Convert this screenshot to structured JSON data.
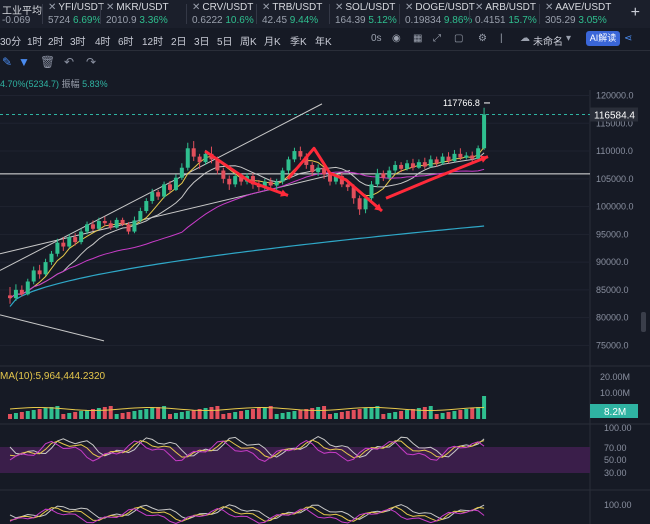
{
  "tickers": [
    {
      "name": "工业平均",
      "price": "-0.069",
      "change": "",
      "pos": 0,
      "closable": false,
      "color": "#e24f5c"
    },
    {
      "name": "YFI/USDT",
      "price": "5724",
      "change": "6.69%",
      "pos": 46,
      "closable": true,
      "color": "#2fbf8f"
    },
    {
      "name": "MKR/USDT",
      "price": "2010.9",
      "change": "3.36%",
      "pos": 104,
      "closable": true,
      "color": "#2fbf8f"
    },
    {
      "name": "CRV/USDT",
      "price": "0.6222",
      "change": "10.6%",
      "pos": 190,
      "closable": true,
      "color": "#2fbf8f"
    },
    {
      "name": "TRB/USDT",
      "price": "42.45",
      "change": "9.44%",
      "pos": 260,
      "closable": true,
      "color": "#2fbf8f"
    },
    {
      "name": "SOL/USDT",
      "price": "164.39",
      "change": "5.12%",
      "pos": 333,
      "closable": true,
      "color": "#2fbf8f"
    },
    {
      "name": "DOGE/USDT",
      "price": "0.19834",
      "change": "9.86%",
      "pos": 403,
      "closable": true,
      "color": "#2fbf8f"
    },
    {
      "name": "ARB/USDT",
      "price": "0.4151",
      "change": "15.7%",
      "pos": 473,
      "closable": true,
      "color": "#2fbf8f"
    },
    {
      "name": "AAVE/USDT",
      "price": "305.29",
      "change": "3.05%",
      "pos": 543,
      "closable": true,
      "color": "#2fbf8f"
    }
  ],
  "timeframes": [
    {
      "label": "30分",
      "pos": 0
    },
    {
      "label": "1时",
      "pos": 27
    },
    {
      "label": "2时",
      "pos": 48
    },
    {
      "label": "3时",
      "pos": 70
    },
    {
      "label": "4时",
      "pos": 95
    },
    {
      "label": "6时",
      "pos": 118
    },
    {
      "label": "12时",
      "pos": 142
    },
    {
      "label": "2日",
      "pos": 171
    },
    {
      "label": "3日",
      "pos": 194
    },
    {
      "label": "5日",
      "pos": 217
    },
    {
      "label": "周K",
      "pos": 240
    },
    {
      "label": "月K",
      "pos": 264
    },
    {
      "label": "季K",
      "pos": 290
    },
    {
      "label": "年K",
      "pos": 315
    }
  ],
  "toolbar": {
    "seconds": "0s",
    "layout_name": "未命名",
    "ai_label": "AI解读"
  },
  "info": {
    "change_text": "4.70%(5234.7)",
    "amplitude_label": "振幅",
    "amplitude_value": "5.83%"
  },
  "volume_ma": {
    "text": "MA(10):5,964,444.2320"
  },
  "price_axis": {
    "ticks": [
      120000,
      115000,
      110000,
      105000,
      100000,
      95000,
      90000,
      85000,
      80000,
      75000
    ],
    "tick_labels": [
      "120000.0",
      "115000.0",
      "110000.0",
      "105000.0",
      "100000.0",
      "95000.0",
      "90000.0",
      "85000.0",
      "80000.0",
      "75000.0"
    ],
    "current": "116584.4",
    "high_label": "117766.8"
  },
  "volume_axis": {
    "labels": [
      "20.00M",
      "10.00M",
      "8.2M"
    ]
  },
  "osc1_axis": {
    "labels": [
      "100.00",
      "70.00",
      "50.00",
      "30.00"
    ]
  },
  "osc2_axis": {
    "labels": [
      "100.00"
    ]
  },
  "chart_data": {
    "type": "candlestick",
    "ylim": [
      72000,
      121000
    ],
    "candles": [
      [
        0,
        84.0,
        83.5,
        85.5,
        82.5
      ],
      [
        1,
        83.5,
        85.0,
        86.0,
        83.0
      ],
      [
        2,
        85.0,
        84.2,
        85.8,
        83.8
      ],
      [
        3,
        84.2,
        86.5,
        87.0,
        84.0
      ],
      [
        4,
        86.5,
        88.5,
        89.2,
        86.0
      ],
      [
        5,
        88.5,
        87.8,
        89.5,
        87.0
      ],
      [
        6,
        87.8,
        90.0,
        90.6,
        87.5
      ],
      [
        7,
        90.0,
        91.5,
        92.0,
        89.5
      ],
      [
        8,
        91.5,
        93.5,
        94.2,
        91.0
      ],
      [
        9,
        93.5,
        92.8,
        94.5,
        92.0
      ],
      [
        10,
        92.8,
        94.5,
        95.0,
        92.5
      ],
      [
        11,
        94.5,
        93.6,
        95.2,
        93.0
      ],
      [
        12,
        93.6,
        95.5,
        96.0,
        93.2
      ],
      [
        13,
        95.5,
        96.8,
        97.3,
        95.0
      ],
      [
        14,
        96.8,
        96.0,
        97.5,
        95.6
      ],
      [
        15,
        96.0,
        97.4,
        98.0,
        95.8
      ],
      [
        16,
        97.4,
        97.0,
        98.2,
        96.5
      ],
      [
        17,
        97.0,
        96.2,
        97.5,
        95.8
      ],
      [
        18,
        96.2,
        97.6,
        98.0,
        96.0
      ],
      [
        19,
        97.6,
        96.8,
        98.0,
        96.5
      ],
      [
        20,
        96.8,
        95.5,
        97.2,
        95.0
      ],
      [
        21,
        95.5,
        97.5,
        98.2,
        95.2
      ],
      [
        22,
        97.5,
        99.2,
        99.8,
        97.2
      ],
      [
        23,
        99.2,
        101.0,
        101.5,
        98.8
      ],
      [
        24,
        101.0,
        102.6,
        103.2,
        100.5
      ],
      [
        25,
        102.6,
        101.8,
        103.0,
        101.2
      ],
      [
        26,
        101.8,
        104.0,
        104.5,
        101.5
      ],
      [
        27,
        104.0,
        103.0,
        104.6,
        102.5
      ],
      [
        28,
        103.0,
        105.2,
        105.8,
        102.8
      ],
      [
        29,
        105.2,
        107.0,
        107.8,
        104.8
      ],
      [
        30,
        107.0,
        110.5,
        111.5,
        106.5
      ],
      [
        31,
        110.5,
        109.0,
        111.8,
        108.2
      ],
      [
        32,
        109.0,
        108.0,
        109.5,
        106.8
      ],
      [
        33,
        108.0,
        109.5,
        110.2,
        107.5
      ],
      [
        34,
        109.5,
        108.5,
        110.8,
        107.8
      ],
      [
        35,
        108.5,
        106.5,
        109.0,
        105.8
      ],
      [
        36,
        106.5,
        105.0,
        107.0,
        104.2
      ],
      [
        37,
        105.0,
        104.0,
        105.6,
        103.0
      ],
      [
        38,
        104.0,
        105.5,
        106.2,
        103.5
      ],
      [
        39,
        105.5,
        104.5,
        106.0,
        103.8
      ],
      [
        40,
        104.5,
        105.5,
        106.0,
        104.0
      ],
      [
        41,
        105.5,
        104.0,
        106.0,
        103.2
      ],
      [
        42,
        104.0,
        103.5,
        104.8,
        102.8
      ],
      [
        43,
        103.5,
        104.5,
        105.0,
        103.0
      ],
      [
        44,
        104.5,
        103.8,
        105.2,
        103.0
      ],
      [
        45,
        103.8,
        104.5,
        105.0,
        103.0
      ],
      [
        46,
        104.5,
        106.5,
        107.0,
        104.0
      ],
      [
        47,
        106.5,
        108.5,
        109.0,
        106.0
      ],
      [
        48,
        108.5,
        110.0,
        110.6,
        108.0
      ],
      [
        49,
        110.0,
        109.0,
        110.8,
        108.4
      ],
      [
        50,
        109.0,
        107.5,
        109.6,
        106.8
      ],
      [
        51,
        107.5,
        106.2,
        108.0,
        105.5
      ],
      [
        52,
        106.2,
        107.0,
        107.6,
        105.5
      ],
      [
        53,
        107.0,
        105.8,
        107.5,
        105.0
      ],
      [
        54,
        105.8,
        104.5,
        106.2,
        103.8
      ],
      [
        55,
        104.5,
        105.5,
        106.0,
        104.0
      ],
      [
        56,
        105.5,
        104.0,
        106.0,
        103.5
      ],
      [
        57,
        104.0,
        103.5,
        104.8,
        102.8
      ],
      [
        58,
        103.5,
        101.5,
        104.0,
        100.5
      ],
      [
        59,
        101.5,
        99.5,
        102.0,
        98.5
      ],
      [
        60,
        99.5,
        101.5,
        102.2,
        98.8
      ],
      [
        61,
        101.5,
        104.0,
        104.6,
        101.0
      ],
      [
        62,
        104.0,
        106.0,
        106.8,
        103.5
      ],
      [
        63,
        106.0,
        105.2,
        106.5,
        104.6
      ],
      [
        64,
        105.2,
        106.5,
        107.2,
        104.8
      ],
      [
        65,
        106.5,
        107.5,
        108.2,
        106.0
      ],
      [
        66,
        107.5,
        106.8,
        108.0,
        106.2
      ],
      [
        67,
        106.8,
        107.8,
        108.4,
        106.5
      ],
      [
        68,
        107.8,
        107.0,
        108.6,
        106.5
      ],
      [
        69,
        107.0,
        108.0,
        108.5,
        106.8
      ],
      [
        70,
        108.0,
        107.2,
        108.8,
        106.8
      ],
      [
        71,
        107.2,
        108.5,
        109.2,
        107.0
      ],
      [
        72,
        108.5,
        107.8,
        109.0,
        107.2
      ],
      [
        73,
        107.8,
        109.0,
        109.6,
        107.5
      ],
      [
        74,
        109.0,
        108.2,
        109.8,
        107.8
      ],
      [
        75,
        108.2,
        109.5,
        110.2,
        108.0
      ],
      [
        76,
        109.5,
        108.8,
        110.5,
        108.4
      ],
      [
        77,
        108.8,
        109.2,
        109.8,
        108.5
      ],
      [
        78,
        109.2,
        108.6,
        109.9,
        108.0
      ],
      [
        79,
        108.6,
        110.5,
        111.0,
        108.4
      ],
      [
        80,
        110.5,
        116.6,
        117.8,
        110.2
      ]
    ]
  }
}
